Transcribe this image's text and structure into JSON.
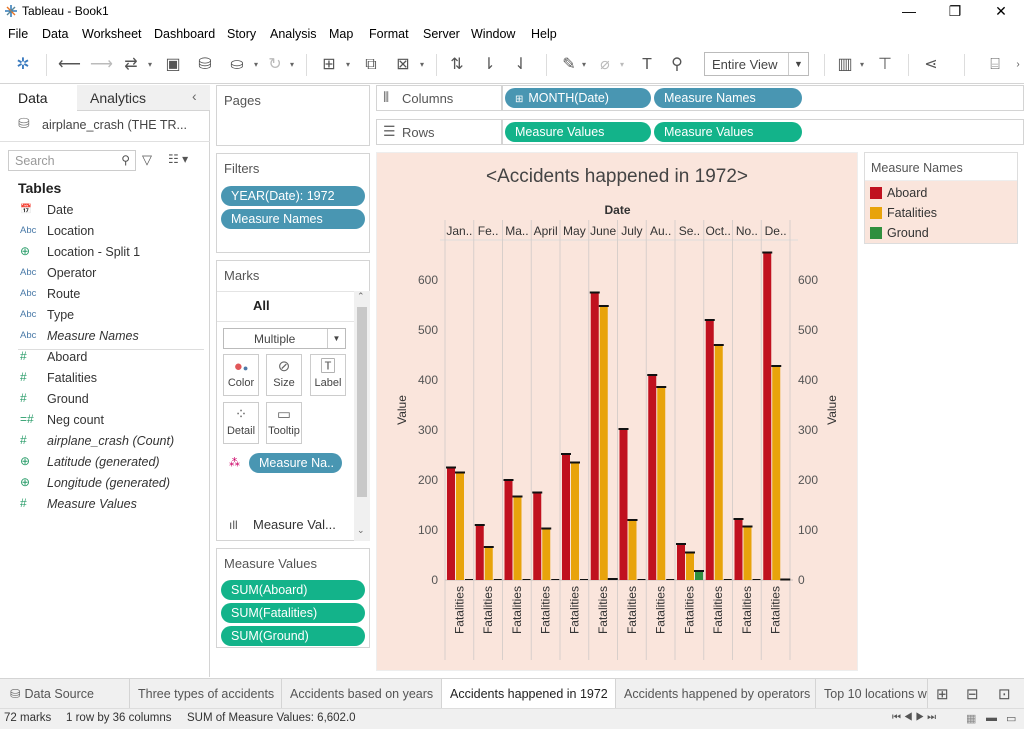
{
  "window": {
    "title": "Tableau - Book1",
    "min": "—",
    "max": "❐",
    "close": "✕"
  },
  "menu": [
    "File",
    "Data",
    "Worksheet",
    "Dashboard",
    "Story",
    "Analysis",
    "Map",
    "Format",
    "Server",
    "Window",
    "Help"
  ],
  "toolbar": {
    "fit_label": "Entire View"
  },
  "left": {
    "tab_data": "Data",
    "tab_analytics": "Analytics",
    "datasource": "airplane_crash (THE TR...",
    "search_placeholder": "Search",
    "tables_title": "Tables",
    "fields": [
      {
        "icon": "📅",
        "type": "date",
        "name": "Date",
        "italic": false
      },
      {
        "icon": "Abc",
        "type": "str",
        "name": "Location",
        "italic": false
      },
      {
        "icon": "⊕",
        "type": "geo",
        "name": "Location - Split 1",
        "italic": false
      },
      {
        "icon": "Abc",
        "type": "str",
        "name": "Operator",
        "italic": false
      },
      {
        "icon": "Abc",
        "type": "str",
        "name": "Route",
        "italic": false
      },
      {
        "icon": "Abc",
        "type": "str",
        "name": "Type",
        "italic": false
      },
      {
        "icon": "Abc",
        "type": "str",
        "name": "Measure Names",
        "italic": true
      },
      {
        "icon": "#",
        "type": "num",
        "name": "Aboard",
        "italic": false
      },
      {
        "icon": "#",
        "type": "num",
        "name": "Fatalities",
        "italic": false
      },
      {
        "icon": "#",
        "type": "num",
        "name": "Ground",
        "italic": false
      },
      {
        "icon": "=#",
        "type": "num",
        "name": "Neg count",
        "italic": false
      },
      {
        "icon": "#",
        "type": "num",
        "name": "airplane_crash (Count)",
        "italic": true
      },
      {
        "icon": "⊕",
        "type": "geo",
        "name": "Latitude (generated)",
        "italic": true
      },
      {
        "icon": "⊕",
        "type": "geo",
        "name": "Longitude (generated)",
        "italic": true
      },
      {
        "icon": "#",
        "type": "num",
        "name": "Measure Values",
        "italic": true
      }
    ]
  },
  "cards": {
    "pages": "Pages",
    "filters": "Filters",
    "filter_pills": [
      "YEAR(Date): 1972",
      "Measure Names"
    ],
    "marks": "Marks",
    "marks_all": "All",
    "mark_type": "Multiple",
    "mark_buttons": [
      "Color",
      "Size",
      "Label",
      "Detail",
      "Tooltip"
    ],
    "marks_pill": "Measure Na..",
    "marks_next": "Measure Val...",
    "measure_values": "Measure Values",
    "mv_pills": [
      "SUM(Aboard)",
      "SUM(Fatalities)",
      "SUM(Ground)"
    ]
  },
  "shelves": {
    "columns_label": "Columns",
    "rows_label": "Rows",
    "columns": [
      "MONTH(Date)",
      "Measure Names"
    ],
    "rows": [
      "Measure Values",
      "Measure Values"
    ],
    "columns_pill_icon": "⊞"
  },
  "legend": {
    "title": "Measure Names",
    "items": [
      {
        "name": "Aboard",
        "color": "#c0111f"
      },
      {
        "name": "Fatalities",
        "color": "#e8a30b"
      },
      {
        "name": "Ground",
        "color": "#2f8f3e"
      }
    ]
  },
  "chart_data": {
    "type": "bar",
    "title": "<Accidents happened in 1972>",
    "header": "Date",
    "categories": [
      "Jan..",
      "Fe..",
      "Ma..",
      "April",
      "May",
      "June",
      "July",
      "Au..",
      "Se..",
      "Oct..",
      "No..",
      "De.."
    ],
    "xlabel": "Fatalities",
    "ylabel": "Value",
    "ylabel_right": "Value",
    "ylim": [
      0,
      660
    ],
    "yticks": [
      0,
      100,
      200,
      300,
      400,
      500,
      600
    ],
    "grid": false,
    "series": [
      {
        "name": "Aboard",
        "color": "#c0111f",
        "values": [
          225,
          110,
          200,
          175,
          252,
          575,
          302,
          410,
          72,
          520,
          122,
          655
        ]
      },
      {
        "name": "Fatalities",
        "color": "#e8a30b",
        "values": [
          215,
          66,
          167,
          103,
          235,
          548,
          120,
          386,
          55,
          470,
          107,
          428
        ]
      },
      {
        "name": "Ground",
        "color": "#2f8f3e",
        "values": [
          0,
          0,
          0,
          0,
          0,
          2,
          0,
          0,
          18,
          0,
          0,
          1
        ]
      }
    ]
  },
  "tabs": [
    "Data Source",
    "Three types of accidents",
    "Accidents based on years",
    "Accidents happened in 1972",
    "Accidents happened by operators",
    "Top 10 locations wh"
  ],
  "status": {
    "marks": "72 marks",
    "dims": "1 row by 36 columns",
    "sum": "SUM of Measure Values: 6,602.0"
  }
}
